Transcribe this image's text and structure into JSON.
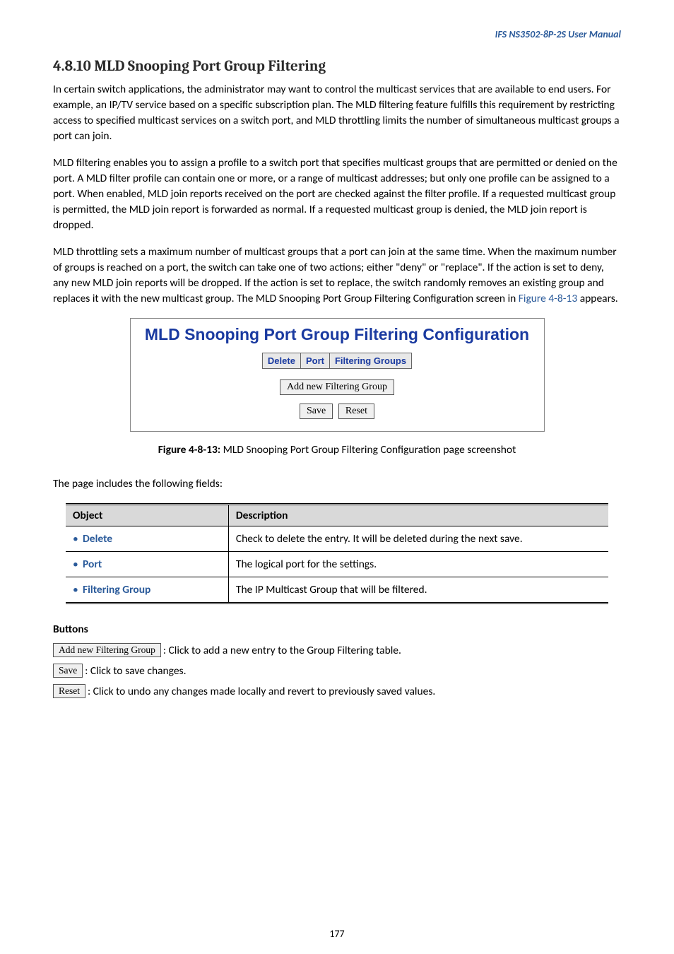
{
  "header_right": "IFS  NS3502-8P-2S   User  Manual",
  "section_heading": "4.8.10 MLD Snooping Port Group Filtering",
  "para1": "In certain switch applications, the administrator may want to control the multicast services that are available to end users. For example, an IP/TV service based on a specific subscription plan. The MLD filtering feature fulfills this requirement by restricting access to specified multicast services on a switch port, and MLD throttling limits the number of simultaneous multicast groups a port can join.",
  "para2": "MLD filtering enables you to assign a profile to a switch port that specifies multicast groups that are permitted or denied on the port. A MLD filter profile can contain one or more, or a range of multicast addresses; but only one profile can be assigned to a port. When enabled, MLD join reports received on the port are checked against the filter profile. If a requested multicast group is permitted, the MLD join report is forwarded as normal. If a requested multicast group is denied, the MLD join report is dropped.",
  "para3_a": "MLD throttling sets a maximum number of multicast groups that a port can join at the same time. When the maximum number of groups is reached on a port, the switch can take one of two actions; either \"deny\" or \"replace\". If the action is set to deny, any new MLD join reports will be dropped. If the action is set to replace, the switch randomly removes an existing group and replaces it with the new multicast group. The MLD Snooping Port Group Filtering Configuration screen in ",
  "para3_link": "Figure 4-8-13",
  "para3_b": " appears.",
  "config_title": "MLD Snooping Port Group Filtering Configuration",
  "mini_headers": {
    "c1": "Delete",
    "c2": "Port",
    "c3": "Filtering Groups"
  },
  "btn_add": "Add new Filtering Group",
  "btn_save": "Save",
  "btn_reset": "Reset",
  "fig_caption_a": "Figure 4-8-13: ",
  "fig_caption_b": "MLD Snooping Port Group Filtering Configuration page screenshot",
  "fields_intro": "The page includes the following fields:",
  "th_object": "Object",
  "th_desc": "Description",
  "row1_obj": "Delete",
  "row1_desc": "Check to delete the entry. It will be deleted during the next save.",
  "row2_obj": "Port",
  "row2_desc": "The logical port for the settings.",
  "row3_obj": "Filtering Group",
  "row3_desc": "The IP Multicast Group that will be filtered.",
  "buttons_heading": "Buttons",
  "btn_add2": "Add new Filtering Group",
  "btn_add2_desc": ": Click to add a new entry to the Group Filtering table.",
  "btn_save2": "Save",
  "btn_save2_desc": ": Click to save changes.",
  "btn_reset2": "Reset",
  "btn_reset2_desc": ": Click to undo any changes made locally and revert to previously saved values.",
  "page_num": "177"
}
